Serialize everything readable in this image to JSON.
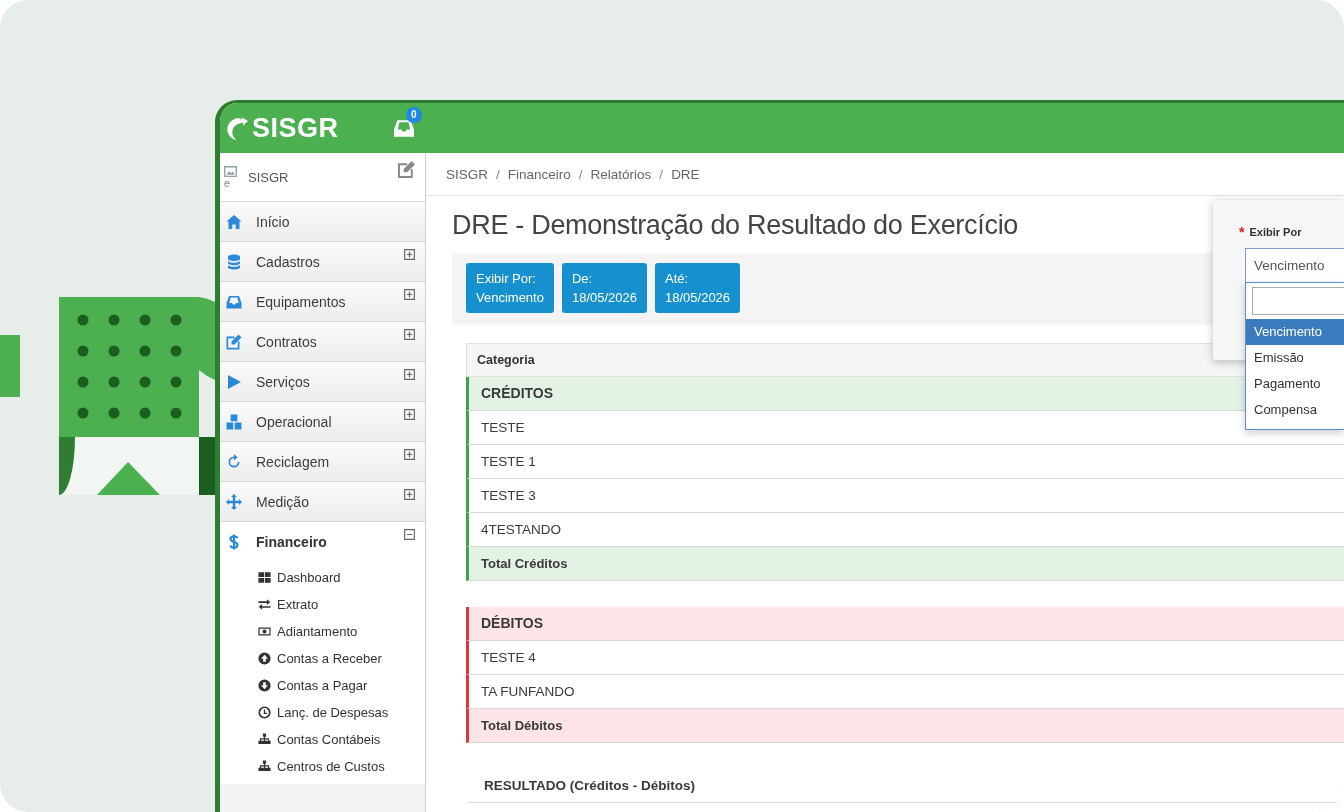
{
  "topbar": {
    "logo_text": "SISGR",
    "inbox_badge": "0"
  },
  "sidebar": {
    "user": {
      "avatar_alt": "e",
      "name": "SISGR"
    },
    "items": [
      {
        "label": "Início",
        "kind": "link",
        "selected": false
      },
      {
        "label": "Cadastros",
        "kind": "group",
        "selected": false,
        "expanded": false
      },
      {
        "label": "Equipamentos",
        "kind": "group",
        "selected": false,
        "expanded": false
      },
      {
        "label": "Contratos",
        "kind": "group",
        "selected": false,
        "expanded": false
      },
      {
        "label": "Serviços",
        "kind": "group",
        "selected": false,
        "expanded": false
      },
      {
        "label": "Operacional",
        "kind": "group",
        "selected": false,
        "expanded": false
      },
      {
        "label": "Reciclagem",
        "kind": "group",
        "selected": false,
        "expanded": false
      },
      {
        "label": "Medição",
        "kind": "group",
        "selected": false,
        "expanded": false
      },
      {
        "label": "Financeiro",
        "kind": "group",
        "selected": true,
        "expanded": true,
        "children": [
          {
            "label": "Dashboard",
            "selected": false
          },
          {
            "label": "Extrato",
            "selected": false
          },
          {
            "label": "Adiantamento",
            "selected": false
          },
          {
            "label": "Contas a Receber",
            "selected": false
          },
          {
            "label": "Contas a Pagar",
            "selected": false
          },
          {
            "label": "Lanç. de Despesas",
            "selected": false
          },
          {
            "label": "Contas Contábeis",
            "selected": false
          },
          {
            "label": "Centros de Custos",
            "selected": false
          }
        ]
      }
    ]
  },
  "main": {
    "breadcrumb": [
      {
        "label": "SISGR",
        "separator": "/"
      },
      {
        "label": "Financeiro",
        "separator": "/"
      },
      {
        "label": "Relatórios",
        "separator": "/"
      },
      {
        "label": "DRE"
      }
    ],
    "title": "DRE - Demonstração do Resultado do Exercício",
    "filters": [
      {
        "label": "Exibir Por:",
        "value": "Vencimento"
      },
      {
        "label": "De:",
        "value": "18/05/2026"
      },
      {
        "label": "Até:",
        "value": "18/05/2026"
      }
    ],
    "table": {
      "columns": [
        "Categoria"
      ],
      "sections": [
        {
          "kind": "credit",
          "title": "CRÉDITOS",
          "rows": [
            "TESTE",
            "TESTE 1",
            "TESTE 3",
            "4TESTANDO"
          ],
          "total": "Total Créditos"
        },
        {
          "kind": "debit",
          "title": "DÉBITOS",
          "rows": [
            "TESTE 4",
            "TA FUNFANDO"
          ],
          "total": "Total Débitos"
        }
      ],
      "result": "RESULTADO (Créditos - Débitos)"
    }
  },
  "filter_popover": {
    "required_mark": "*",
    "label": "Exibir Por",
    "value": "Vencimento",
    "options": [
      {
        "label": "Vencimento",
        "selected": true
      },
      {
        "label": "Emissão",
        "selected": false
      },
      {
        "label": "Pagamento",
        "selected": false
      },
      {
        "label": "Compensa",
        "selected": false
      }
    ]
  }
}
